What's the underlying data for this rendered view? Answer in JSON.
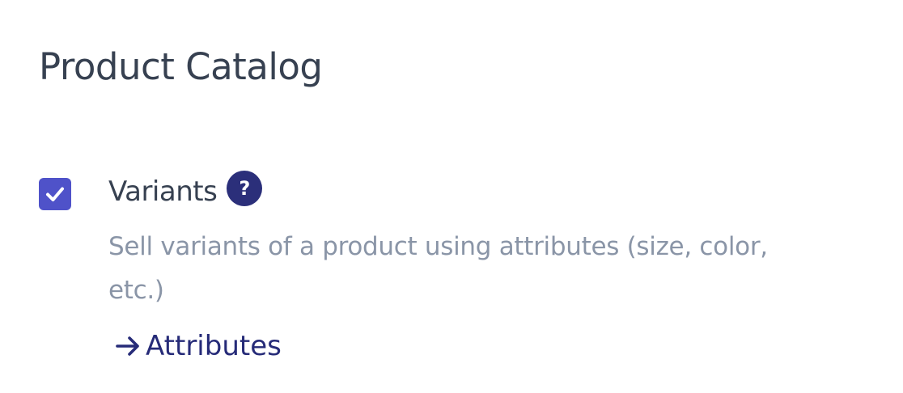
{
  "section": {
    "title": "Product Catalog"
  },
  "setting": {
    "name": "Variants",
    "enabled": true,
    "help_icon": "question-mark",
    "help_symbol": "?",
    "description": "Sell variants of a product using attributes (size, color, etc.)",
    "link": {
      "icon": "arrow-right",
      "label": "Attributes"
    }
  },
  "colors": {
    "checkbox": "#4f52c9",
    "help_icon": "#2b2f7a",
    "link": "#262b78",
    "title": "#374151",
    "description": "#8a95a7"
  }
}
